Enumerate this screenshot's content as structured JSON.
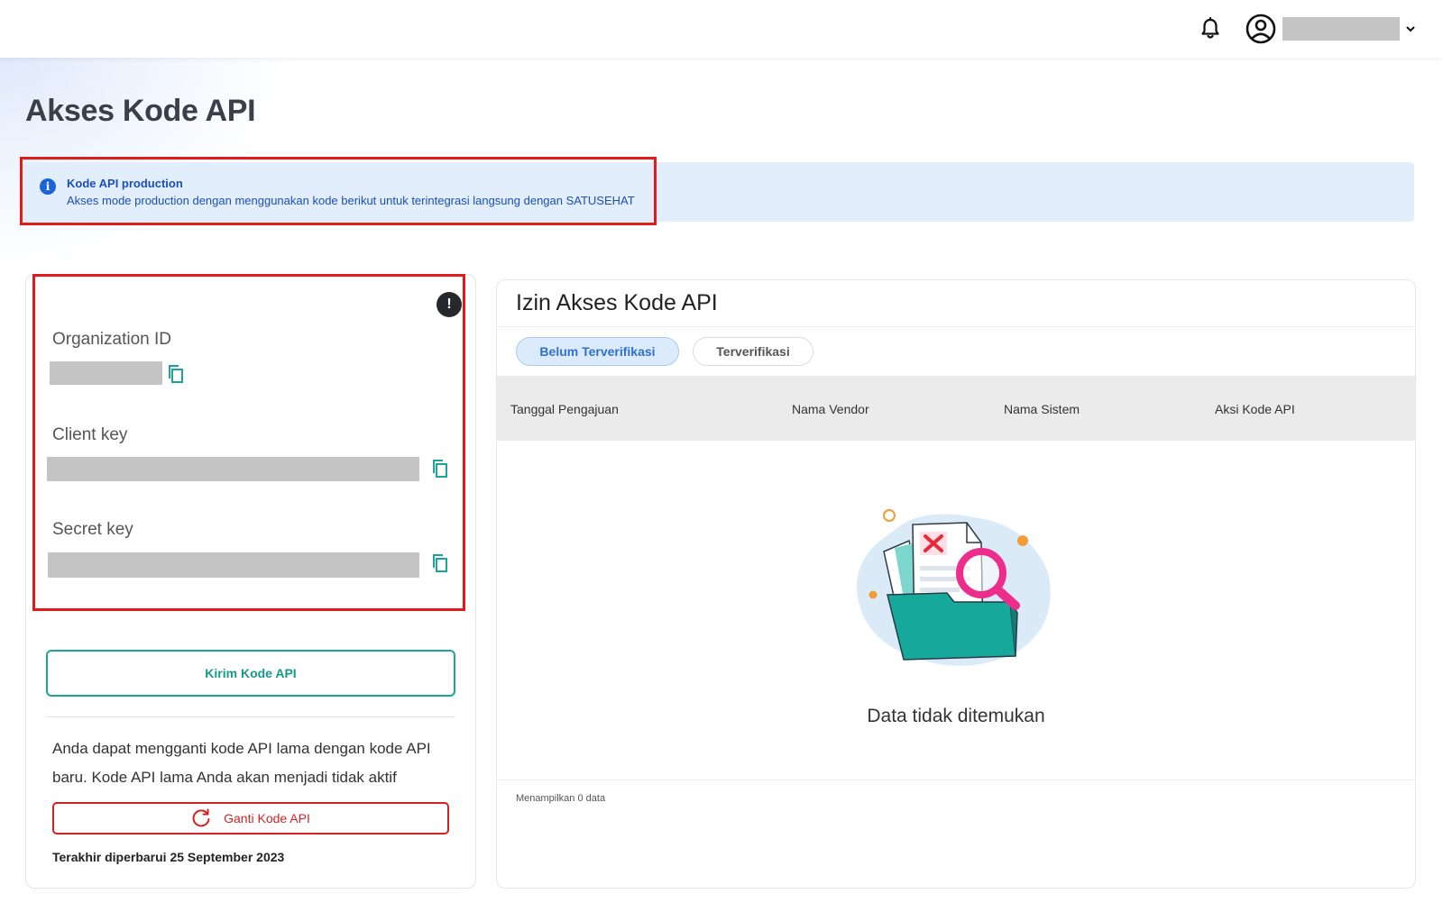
{
  "header": {
    "user_name_redacted": true
  },
  "page": {
    "title": "Akses Kode API"
  },
  "info": {
    "title": "Kode API production",
    "description": "Akses mode production dengan menggunakan kode berikut untuk terintegrasi langsung dengan SATUSEHAT"
  },
  "credentials": {
    "org_label": "Organization ID",
    "client_label": "Client key",
    "secret_label": "Secret key",
    "alert_glyph": "!",
    "send_button": "Kirim Kode API",
    "replace_text": "Anda dapat mengganti kode API lama dengan kode API baru. Kode API lama Anda akan menjadi tidak aktif",
    "replace_button": "Ganti Kode API",
    "last_updated": "Terakhir diperbarui 25 September 2023"
  },
  "permissions": {
    "title": "Izin Akses Kode API",
    "tabs": [
      "Belum Terverifikasi",
      "Terverifikasi"
    ],
    "active_tab": "Belum Terverifikasi",
    "columns": [
      "Tanggal Pengajuan",
      "Nama Vendor",
      "Nama Sistem",
      "Aksi Kode API"
    ],
    "empty_text": "Data tidak ditemukan",
    "footer": "Menampilkan 0 data"
  },
  "colors": {
    "accent_teal": "#1aa79a",
    "danger_red": "#d42222",
    "info_blue": "#1b4fb8",
    "highlight_red": "#e21a1a"
  },
  "icons": {
    "notification": "bell-icon",
    "profile": "user-circle-icon",
    "dropdown": "chevron-down-icon",
    "info": "info-icon",
    "copy": "copy-icon",
    "refresh": "refresh-icon"
  }
}
